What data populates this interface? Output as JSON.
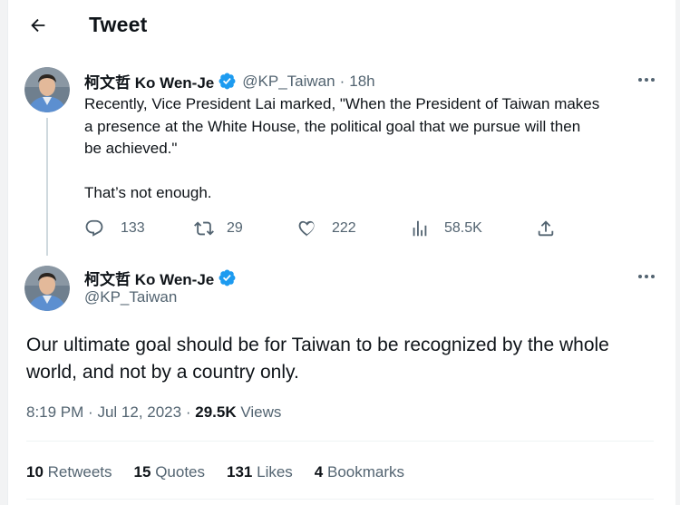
{
  "header": {
    "title": "Tweet"
  },
  "reply_tweet": {
    "name": "柯文哲 Ko Wen-Je",
    "handle": "@KP_Taiwan",
    "separator": "·",
    "time": "18h",
    "text_line1": "Recently, Vice President Lai marked, \"When the President of Taiwan makes",
    "text_line2": "a presence at the White House, the political goal that we pursue will then",
    "text_line3": "be achieved.\"",
    "text_line4": "That’s not enough.",
    "replies": "133",
    "retweets": "29",
    "likes": "222",
    "views": "58.5K"
  },
  "main_tweet": {
    "name": "柯文哲 Ko Wen-Je",
    "handle": "@KP_Taiwan",
    "text_line1": "Our ultimate goal should be for Taiwan to be recognized by the whole",
    "text_line2": "world, and not by a country only.",
    "time": "8:19 PM",
    "separator1": "·",
    "date": "Jul 12, 2023",
    "separator2": "·",
    "views_count": "29.5K",
    "views_label": "Views",
    "stats": {
      "retweets_count": "10",
      "retweets_label": "Retweets",
      "quotes_count": "15",
      "quotes_label": "Quotes",
      "likes_count": "131",
      "likes_label": "Likes",
      "bookmarks_count": "4",
      "bookmarks_label": "Bookmarks"
    }
  },
  "colors": {
    "text": "#0f1419",
    "secondary": "#536471",
    "verified": "#1d9bf0",
    "divider": "#eff3f4"
  },
  "icons": {
    "back": "arrow-left-icon",
    "verified": "verified-badge-icon",
    "more": "more-dots-icon",
    "reply": "reply-bubble-icon",
    "retweet": "retweet-icon",
    "like": "heart-icon",
    "views": "bar-chart-icon",
    "share": "share-icon"
  }
}
